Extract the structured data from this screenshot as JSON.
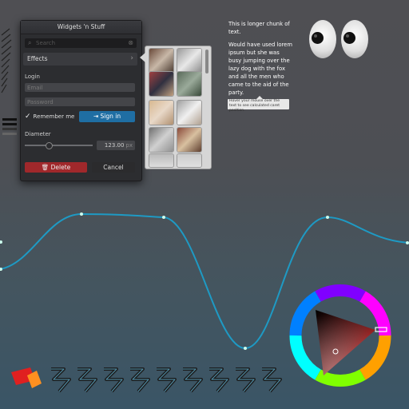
{
  "window": {
    "title": "Widgets 'n Stuff",
    "search_placeholder": "Search",
    "search_icon": "search-icon",
    "clear_icon": "clear-icon",
    "effects_label": "Effects",
    "login_label": "Login",
    "email_placeholder": "Email",
    "password_placeholder": "Password",
    "remember_label": "Remember me",
    "remember_checked": true,
    "signin_label": "Sign in",
    "diameter_label": "Diameter",
    "diameter_value": "123.00",
    "diameter_unit": "px",
    "diameter_fraction": 0.35,
    "delete_label": "Delete",
    "cancel_label": "Cancel"
  },
  "paragraph": {
    "line1": "This is longer chunk of text.",
    "line2": "Would have used lorem ipsum but she was busy jumping over the lazy dog with the fox and all the men who came to the aid of the party."
  },
  "tooltip": "Hover your mouse over the text to see calculated caret position.",
  "colors": {
    "accent": "#1f6ea3",
    "danger": "#a0282b",
    "graph_line": "#1e9ac4",
    "selection": "#ff3030"
  }
}
